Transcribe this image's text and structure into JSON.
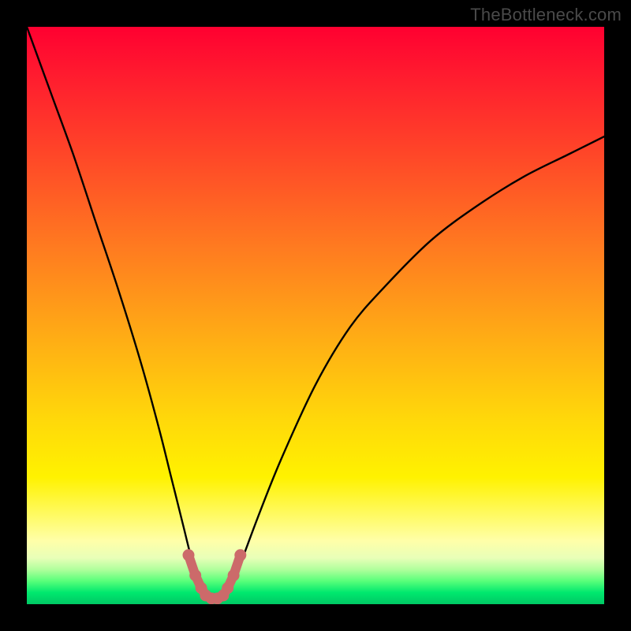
{
  "watermark": "TheBottleneck.com",
  "colors": {
    "frame": "#000000",
    "grad_top": "#ff0030",
    "grad_mid": "#ffd80a",
    "grad_low": "#fffb6a",
    "grad_bottom": "#00c864",
    "curve": "#000000",
    "marker_fill": "#cc6a6a",
    "marker_stroke": "#8a3b3b"
  },
  "chart_data": {
    "type": "line",
    "title": "",
    "xlabel": "",
    "ylabel": "",
    "xlim": [
      0,
      100
    ],
    "ylim": [
      0,
      100
    ],
    "grid": false,
    "legend": false,
    "series": [
      {
        "name": "bottleneck-curve",
        "x": [
          0,
          4,
          8,
          12,
          16,
          20,
          23,
          25,
          27,
          28.5,
          30,
          31,
          32,
          33,
          34,
          35.5,
          37,
          40,
          44,
          50,
          56,
          62,
          70,
          78,
          86,
          94,
          100
        ],
        "y": [
          100,
          89,
          78,
          66,
          54,
          41,
          30,
          22,
          14,
          8,
          3.5,
          1.2,
          0.5,
          0.5,
          1.2,
          3.5,
          7,
          15,
          25,
          38,
          48,
          55,
          63,
          69,
          74,
          78,
          81
        ]
      }
    ],
    "markers": {
      "name": "bottom-highlight",
      "x": [
        28.0,
        29.2,
        30.2,
        31.0,
        32.0,
        33.0,
        34.0,
        34.8,
        35.8,
        37.0
      ],
      "y": [
        8.5,
        5.0,
        2.8,
        1.5,
        1.0,
        1.0,
        1.5,
        2.8,
        5.0,
        8.5
      ]
    }
  }
}
